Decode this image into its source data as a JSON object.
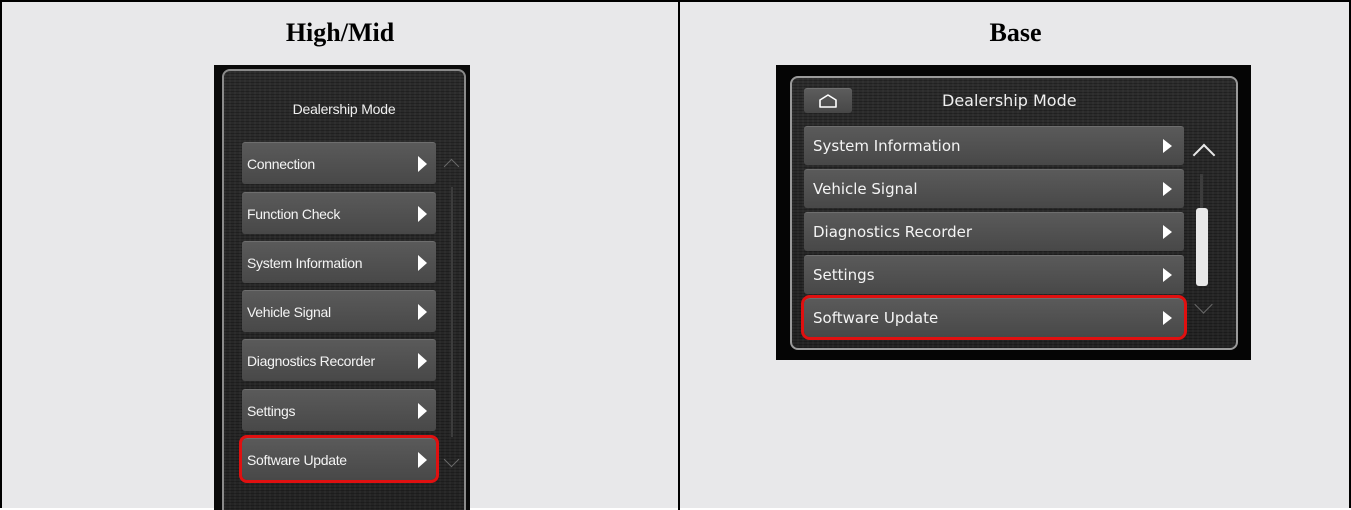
{
  "columns": {
    "left_header": "High/Mid",
    "right_header": "Base"
  },
  "high_mid": {
    "title": "Dealership Mode",
    "items": [
      {
        "label": "Connection"
      },
      {
        "label": "Function Check"
      },
      {
        "label": "System Information"
      },
      {
        "label": "Vehicle Signal"
      },
      {
        "label": "Diagnostics Recorder"
      },
      {
        "label": "Settings"
      },
      {
        "label": "Software Update",
        "highlighted": true
      }
    ]
  },
  "base": {
    "title": "Dealership Mode",
    "home_icon": "home-icon",
    "items": [
      {
        "label": "System Information"
      },
      {
        "label": "Vehicle Signal"
      },
      {
        "label": "Diagnostics Recorder"
      },
      {
        "label": "Settings"
      },
      {
        "label": "Software Update",
        "highlighted": true
      }
    ],
    "scroll_position": 0.4
  },
  "colors": {
    "highlight": "#e01010",
    "button": "#525252",
    "screen_background": "#262626"
  }
}
